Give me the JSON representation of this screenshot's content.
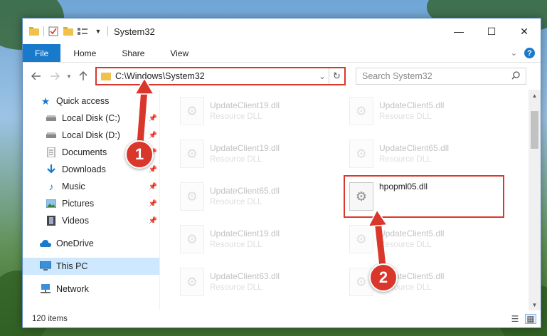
{
  "window": {
    "title": "System32",
    "controls": {
      "minimize": "—",
      "maximize": "☐",
      "close": "✕"
    }
  },
  "ribbon": {
    "tabs": [
      {
        "label": "File"
      },
      {
        "label": "Home"
      },
      {
        "label": "Share"
      },
      {
        "label": "View"
      }
    ],
    "help": "?"
  },
  "address": {
    "path": "C:\\Windows\\System32",
    "search_placeholder": "Search System32"
  },
  "nav_pane": {
    "quick_access": "Quick access",
    "items": [
      {
        "label": "Local Disk (C:)",
        "icon": "drive-icon"
      },
      {
        "label": "Local Disk (D:)",
        "icon": "drive-icon"
      },
      {
        "label": "Documents",
        "icon": "documents-icon"
      },
      {
        "label": "Downloads",
        "icon": "downloads-icon"
      },
      {
        "label": "Music",
        "icon": "music-icon"
      },
      {
        "label": "Pictures",
        "icon": "pictures-icon"
      },
      {
        "label": "Videos",
        "icon": "videos-icon"
      }
    ],
    "onedrive": "OneDrive",
    "this_pc": "This PC",
    "network": "Network"
  },
  "files": [
    {
      "name": "UpdateClient19.dll",
      "type": "Resource DLL"
    },
    {
      "name": "UpdateClient5.dll",
      "type": "Resource DLL"
    },
    {
      "name": "UpdateClient19.dll",
      "type": "Resource DLL"
    },
    {
      "name": "UpdateClient65.dll",
      "type": "Resource DLL"
    },
    {
      "name": "UpdateClient65.dll",
      "type": "Resource DLL"
    },
    {
      "name": "hpopml05.dll",
      "type": ""
    },
    {
      "name": "UpdateClient19.dll",
      "type": "Resource DLL"
    },
    {
      "name": "UpdateClient5.dll",
      "type": "Resource DLL"
    },
    {
      "name": "UpdateClient63.dll",
      "type": "Resource DLL"
    },
    {
      "name": "UpdateClient5.dll",
      "type": "Resource DLL"
    }
  ],
  "status": {
    "item_count": "120 items"
  },
  "annotations": {
    "step1": "1",
    "step2": "2",
    "color": "#d9372b"
  }
}
